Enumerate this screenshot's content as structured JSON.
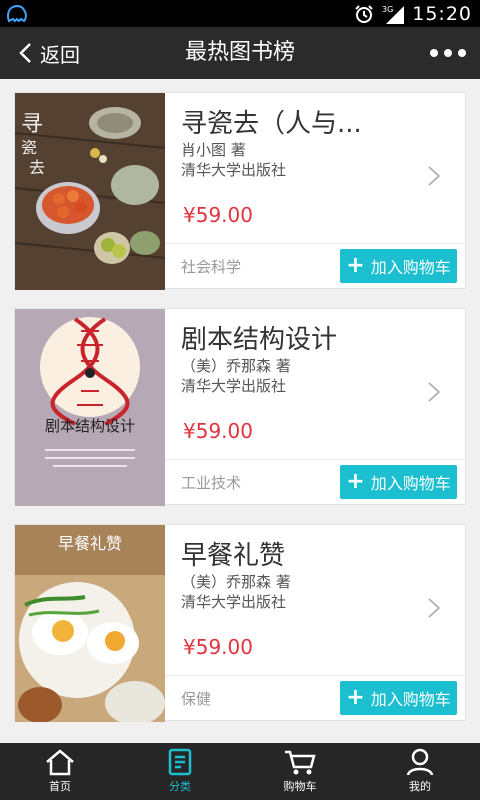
{
  "status_bar": {
    "time": "15:20",
    "network": "3G"
  },
  "header": {
    "back_label": "返回",
    "title": "最热图书榜"
  },
  "books": [
    {
      "title": "寻瓷去（人与...",
      "author": "肖小图 著",
      "publisher": "清华大学出版社",
      "price": "¥59.00",
      "category": "社会科学",
      "add_to_cart": "加入购物车",
      "cover_text": "寻瓷去"
    },
    {
      "title": "剧本结构设计",
      "author": "（美）乔那森 著",
      "publisher": "清华大学出版社",
      "price": "¥59.00",
      "category": "工业技术",
      "add_to_cart": "加入购物车",
      "cover_text": "剧本结构设计"
    },
    {
      "title": "早餐礼赞",
      "author": "（美）乔那森 著",
      "publisher": "清华大学出版社",
      "price": "¥59.00",
      "category": "保健",
      "add_to_cart": "加入购物车",
      "cover_text": "早餐礼赞"
    }
  ],
  "tabs": [
    {
      "label": "首页",
      "icon": "home-icon"
    },
    {
      "label": "分类",
      "icon": "category-icon",
      "active": true
    },
    {
      "label": "购物车",
      "icon": "cart-icon"
    },
    {
      "label": "我的",
      "icon": "profile-icon"
    }
  ],
  "colors": {
    "accent": "#1bbfcf",
    "price": "#e0343c",
    "header_bg": "#2b2b2b",
    "tabbar_bg": "#262626"
  }
}
